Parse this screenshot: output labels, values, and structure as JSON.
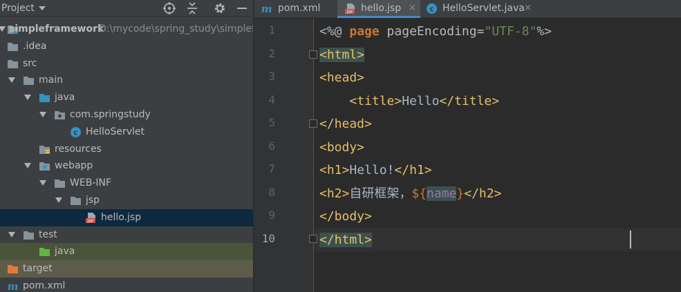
{
  "project": {
    "title": "Project",
    "header_icons": [
      "crosshair-icon",
      "collapse-all-icon",
      "gear-icon",
      "minimize-icon"
    ]
  },
  "tree": [
    {
      "label": "simpleframework",
      "path": "D:\\mycode\\spring_study\\simplefr",
      "icon": "module-folder-icon",
      "expanded": true,
      "level": 0
    },
    {
      "label": ".idea",
      "icon": "folder-icon",
      "level": 1
    },
    {
      "label": "src",
      "icon": "folder-icon",
      "level": 1
    },
    {
      "label": "main",
      "icon": "folder-icon",
      "expanded": true,
      "level": 1
    },
    {
      "label": "java",
      "icon": "source-folder-icon",
      "expanded": true,
      "level": 2
    },
    {
      "label": "com.springstudy",
      "icon": "package-icon",
      "expanded": true,
      "level": 3
    },
    {
      "label": "HelloServlet",
      "icon": "java-class-icon",
      "level": 4
    },
    {
      "label": "resources",
      "icon": "resources-folder-icon",
      "level": 2
    },
    {
      "label": "webapp",
      "icon": "web-folder-icon",
      "expanded": true,
      "level": 2
    },
    {
      "label": "WEB-INF",
      "icon": "folder-icon",
      "expanded": true,
      "level": 3
    },
    {
      "label": "jsp",
      "icon": "folder-icon",
      "expanded": true,
      "level": 4
    },
    {
      "label": "hello.jsp",
      "icon": "jsp-file-icon",
      "level": 5,
      "selected": true
    },
    {
      "label": "test",
      "icon": "folder-icon",
      "expanded": true,
      "level": 1
    },
    {
      "label": "java",
      "icon": "test-folder-icon",
      "level": 2
    },
    {
      "label": "target",
      "icon": "excluded-folder-icon",
      "level": 1
    },
    {
      "label": "pom.xml",
      "icon": "maven-icon",
      "level": 1
    }
  ],
  "tabs": [
    {
      "label": "pom.xml",
      "icon": "maven-icon",
      "active": false
    },
    {
      "label": "hello.jsp",
      "icon": "jsp-file-icon",
      "active": true
    },
    {
      "label": "HelloServlet.java",
      "icon": "java-class-icon",
      "active": false
    }
  ],
  "tab_close": "×",
  "editor": {
    "line_numbers": [
      "1",
      "2",
      "3",
      "4",
      "5",
      "6",
      "7",
      "8",
      "9",
      "10"
    ],
    "current_line": "10",
    "lines": [
      [
        {
          "t": "<%@ ",
          "c": "t-text"
        },
        {
          "t": "page",
          "c": "t-kw"
        },
        {
          "t": " pageEncoding=",
          "c": "t-attr"
        },
        {
          "t": "\"UTF-8\"",
          "c": "t-val"
        },
        {
          "t": "%>",
          "c": "t-text"
        }
      ],
      [
        {
          "t": "<html>",
          "c": "t-tag hl-tag"
        }
      ],
      [
        {
          "t": "<head>",
          "c": "t-tag"
        }
      ],
      [
        {
          "t": "    ",
          "c": "t-text"
        },
        {
          "t": "<title>",
          "c": "t-tag"
        },
        {
          "t": "Hello",
          "c": "t-text"
        },
        {
          "t": "</title>",
          "c": "t-tag"
        }
      ],
      [
        {
          "t": "</head>",
          "c": "t-tag"
        }
      ],
      [
        {
          "t": "<body>",
          "c": "t-tag"
        }
      ],
      [
        {
          "t": "<h1>",
          "c": "t-tag"
        },
        {
          "t": "Hello!",
          "c": "t-text"
        },
        {
          "t": "</h1>",
          "c": "t-tag"
        }
      ],
      [
        {
          "t": "<h2>",
          "c": "t-tag"
        },
        {
          "t": "自研框架，",
          "c": "t-text"
        },
        {
          "t": "${",
          "c": "t-el"
        },
        {
          "t": "name",
          "c": "t-var hl-tag"
        },
        {
          "t": "}",
          "c": "t-el"
        },
        {
          "t": "</h2>",
          "c": "t-tag"
        }
      ],
      [
        {
          "t": "</body>",
          "c": "t-tag"
        }
      ],
      [
        {
          "t": "</html>",
          "c": "t-tag hl-tag"
        }
      ]
    ]
  },
  "colors": {
    "accent": "#4a88c7",
    "selection": "#0d293e",
    "tag": "#e8bf6a"
  }
}
